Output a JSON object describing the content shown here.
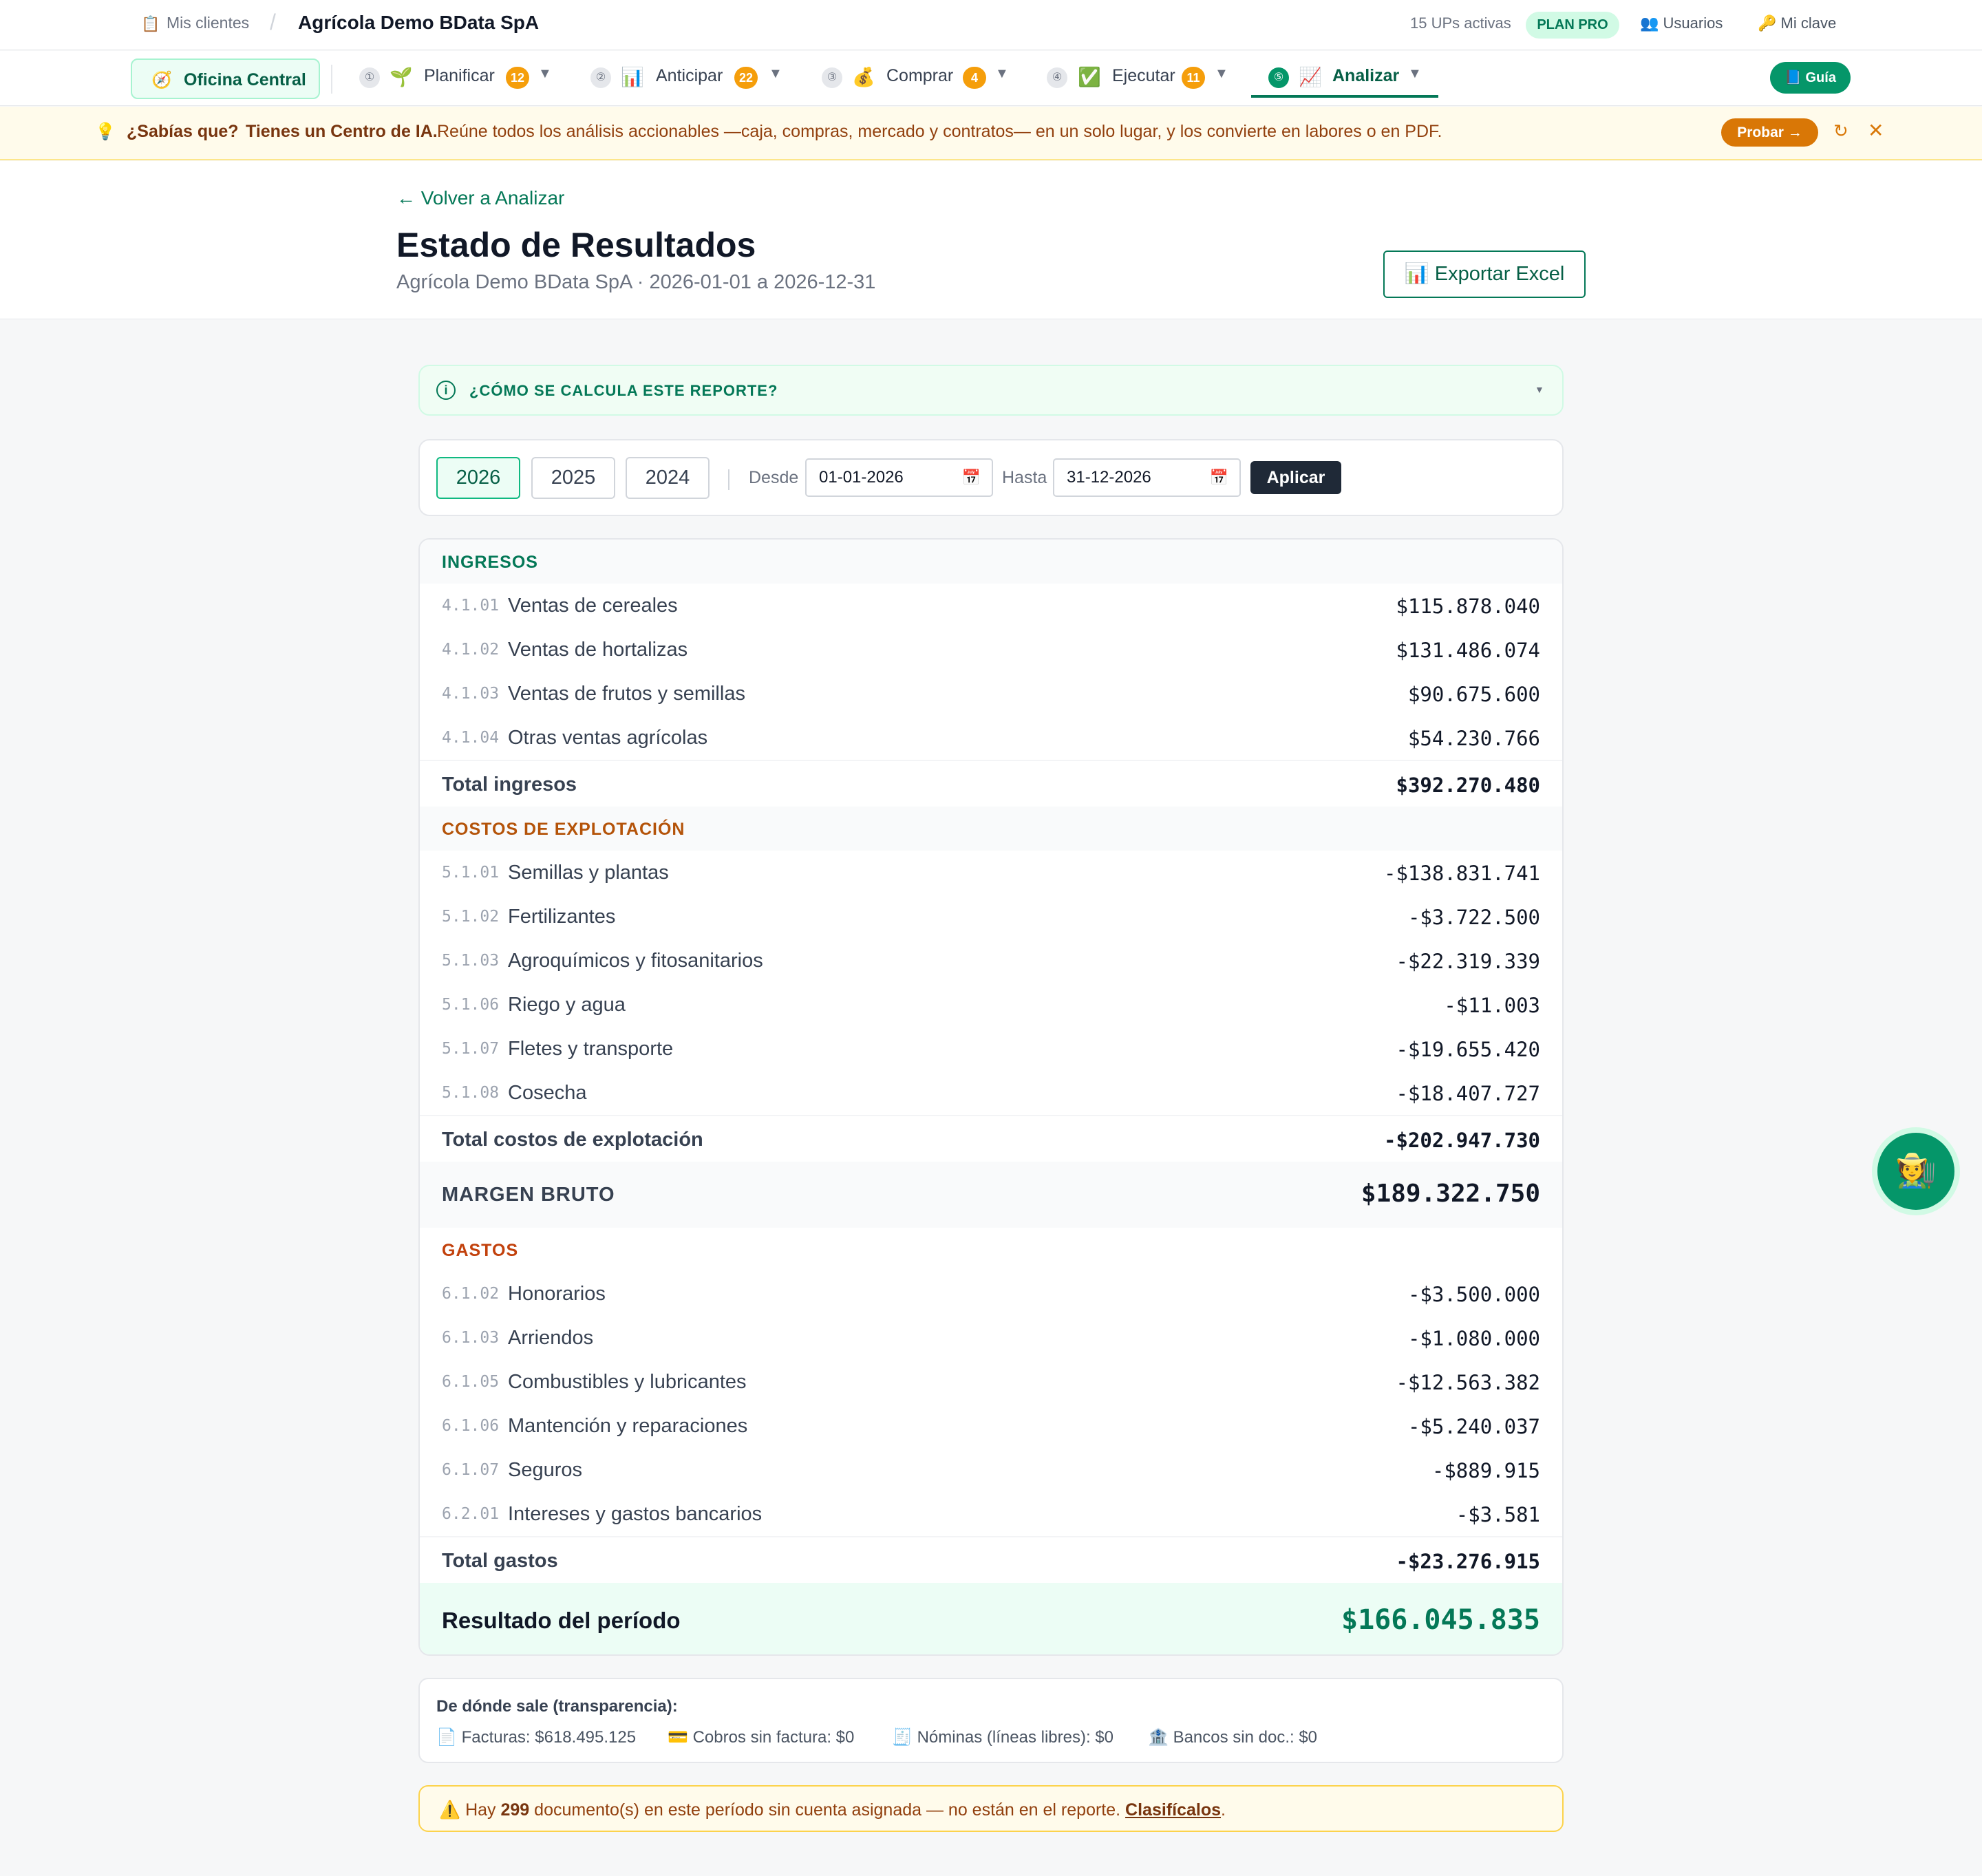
{
  "topbar": {
    "clients_icon": "clipboard-icon",
    "clients_label": "Mis clientes",
    "separator": "/",
    "company": "Agrícola Demo BData SpA",
    "ups_active": "15 UPs activas",
    "plan_badge": "PLAN PRO",
    "users_label": "Usuarios",
    "password_label": "Mi clave"
  },
  "nav": {
    "office_label": "Oficina Central",
    "items": [
      {
        "num": "①",
        "emoji": "🌱",
        "label": "Planificar",
        "badge": "12"
      },
      {
        "num": "②",
        "emoji": "📊",
        "label": "Anticipar",
        "badge": "22"
      },
      {
        "num": "③",
        "emoji": "💰",
        "label": "Comprar",
        "badge": "4"
      },
      {
        "num": "④",
        "emoji": "✅",
        "label": "Ejecutar",
        "badge": "11"
      },
      {
        "num": "⑤",
        "emoji": "📈",
        "label": "Analizar",
        "badge": ""
      }
    ],
    "guide_label": "📘 Guía"
  },
  "tip": {
    "question": "¿Sabías que?",
    "headline": "Tienes un Centro de IA.",
    "text": "Reúne todos los análisis accionables —caja, compras, mercado y contratos— en un solo lugar, y los convierte en labores o en PDF.",
    "cta": "Probar →"
  },
  "header": {
    "back": "← Volver a Analizar",
    "title": "Estado de Resultados",
    "subtitle": "Agrícola Demo BData SpA · 2026-01-01 a 2026-12-31",
    "export": "📊 Exportar Excel"
  },
  "how": {
    "label": "¿CÓMO SE CALCULA ESTE REPORTE?"
  },
  "filters": {
    "years": [
      "2026",
      "2025",
      "2024"
    ],
    "selected_year": "2026",
    "from_label": "Desde",
    "from_value": "01-01-2026",
    "to_label": "Hasta",
    "to_value": "31-12-2026",
    "apply": "Aplicar"
  },
  "statement": {
    "income": {
      "title": "INGRESOS",
      "color": "#047857",
      "rows": [
        {
          "code": "4.1.01",
          "name": "Ventas de cereales",
          "amount": "$115.878.040"
        },
        {
          "code": "4.1.02",
          "name": "Ventas de hortalizas",
          "amount": "$131.486.074"
        },
        {
          "code": "4.1.03",
          "name": "Ventas de frutos y semillas",
          "amount": "$90.675.600"
        },
        {
          "code": "4.1.04",
          "name": "Otras ventas agrícolas",
          "amount": "$54.230.766"
        }
      ],
      "total_label": "Total ingresos",
      "total": "$392.270.480"
    },
    "costs": {
      "title": "COSTOS DE EXPLOTACIÓN",
      "color": "#b45309",
      "rows": [
        {
          "code": "5.1.01",
          "name": "Semillas y plantas",
          "amount": "-$138.831.741"
        },
        {
          "code": "5.1.02",
          "name": "Fertilizantes",
          "amount": "-$3.722.500"
        },
        {
          "code": "5.1.03",
          "name": "Agroquímicos y fitosanitarios",
          "amount": "-$22.319.339"
        },
        {
          "code": "5.1.06",
          "name": "Riego y agua",
          "amount": "-$11.003"
        },
        {
          "code": "5.1.07",
          "name": "Fletes y transporte",
          "amount": "-$19.655.420"
        },
        {
          "code": "5.1.08",
          "name": "Cosecha",
          "amount": "-$18.407.727"
        }
      ],
      "total_label": "Total costos de explotación",
      "total": "-$202.947.730"
    },
    "gross_margin_label": "MARGEN BRUTO",
    "gross_margin": "$189.322.750",
    "expenses": {
      "title": "GASTOS",
      "color": "#c2410c",
      "rows": [
        {
          "code": "6.1.02",
          "name": "Honorarios",
          "amount": "-$3.500.000"
        },
        {
          "code": "6.1.03",
          "name": "Arriendos",
          "amount": "-$1.080.000"
        },
        {
          "code": "6.1.05",
          "name": "Combustibles y lubricantes",
          "amount": "-$12.563.382"
        },
        {
          "code": "6.1.06",
          "name": "Mantención y reparaciones",
          "amount": "-$5.240.037"
        },
        {
          "code": "6.1.07",
          "name": "Seguros",
          "amount": "-$889.915"
        },
        {
          "code": "6.2.01",
          "name": "Intereses y gastos bancarios",
          "amount": "-$3.581"
        }
      ],
      "total_label": "Total gastos",
      "total": "-$23.276.915"
    },
    "result_label": "Resultado del período",
    "result": "$166.045.835"
  },
  "transparency": {
    "heading": "De dónde sale (transparencia):",
    "items": [
      {
        "icon": "invoice-icon",
        "text": "Facturas: $618.495.125"
      },
      {
        "icon": "card-icon",
        "text": "Cobros sin factura: $0"
      },
      {
        "icon": "receipt-icon",
        "text": "Nóminas (líneas libres): $0"
      },
      {
        "icon": "bank-icon",
        "text": "Bancos sin doc.: $0"
      }
    ]
  },
  "warning": {
    "prefix": "Hay ",
    "count": "299",
    "middle": " documento(s) en este período sin cuenta asignada — no están en el reporte. ",
    "link": "Clasifícalos",
    "suffix": "."
  }
}
